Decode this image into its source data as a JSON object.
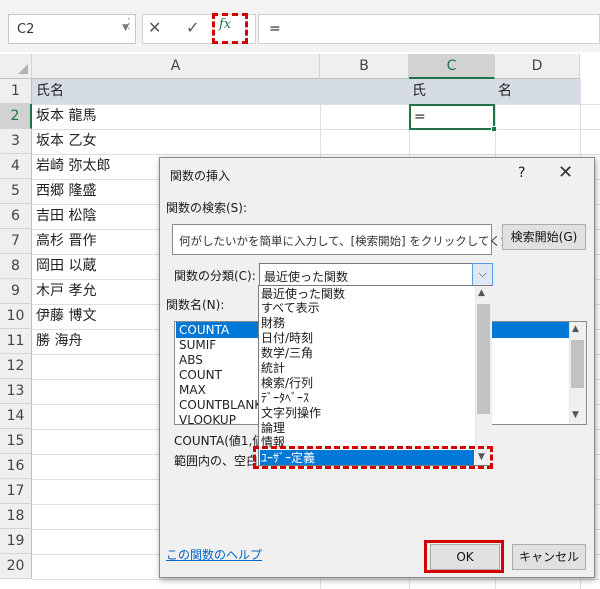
{
  "formula_bar": {
    "name_box": "C2",
    "cancel_glyph": "✕",
    "enter_glyph": "✓",
    "fx_label": "fx",
    "formula": "="
  },
  "sheet": {
    "columns": [
      "A",
      "B",
      "C",
      "D"
    ],
    "selected_column": "C",
    "rows": [
      "1",
      "2",
      "3",
      "4",
      "5",
      "6",
      "7",
      "8",
      "9",
      "10",
      "11",
      "12",
      "13",
      "14",
      "15",
      "16",
      "17",
      "18",
      "19",
      "20"
    ],
    "selected_row": "2",
    "header_cells": {
      "A1": "氏名",
      "C1": "氏",
      "D1": "名"
    },
    "names": [
      "坂本 龍馬",
      "坂本 乙女",
      "岩崎 弥太郎",
      "西郷 隆盛",
      "吉田 松陰",
      "高杉 晋作",
      "岡田 以蔵",
      "木戸 孝允",
      "伊藤 博文",
      "勝 海舟"
    ],
    "active_cell_value": "="
  },
  "dialog": {
    "title": "関数の挿入",
    "help_glyph": "?",
    "close_glyph": "✕",
    "search_label": "関数の検索(S):",
    "search_text": "何がしたいかを簡単に入力して、[検索開始] をクリックしてください。",
    "search_button": "検索開始(G)",
    "category_label": "関数の分類(C):",
    "category_value": "最近使った関数",
    "function_name_label": "関数名(N):",
    "functions": [
      "COUNTA",
      "SUMIF",
      "ABS",
      "COUNT",
      "MAX",
      "COUNTBLANK",
      "VLOOKUP"
    ],
    "selected_function": "COUNTA",
    "syntax": "COUNTA(値1,値",
    "description": "範囲内の、空白で",
    "help_link": "この関数のヘルプ",
    "ok_button": "OK",
    "cancel_button": "キャンセル",
    "category_options": [
      "最近使った関数",
      "すべて表示",
      "財務",
      "日付/時刻",
      "数学/三角",
      "統計",
      "検索/行列",
      "ﾃﾞｰﾀﾍﾞｰｽ",
      "文字列操作",
      "論理",
      "情報",
      "ﾕｰｻﾞｰ定義"
    ],
    "highlighted_option": "ﾕｰｻﾞｰ定義"
  },
  "colors": {
    "excel_green": "#217346",
    "highlight_red": "#d40000",
    "selection_blue": "#0078d7",
    "header_band": "#d6dce4"
  }
}
